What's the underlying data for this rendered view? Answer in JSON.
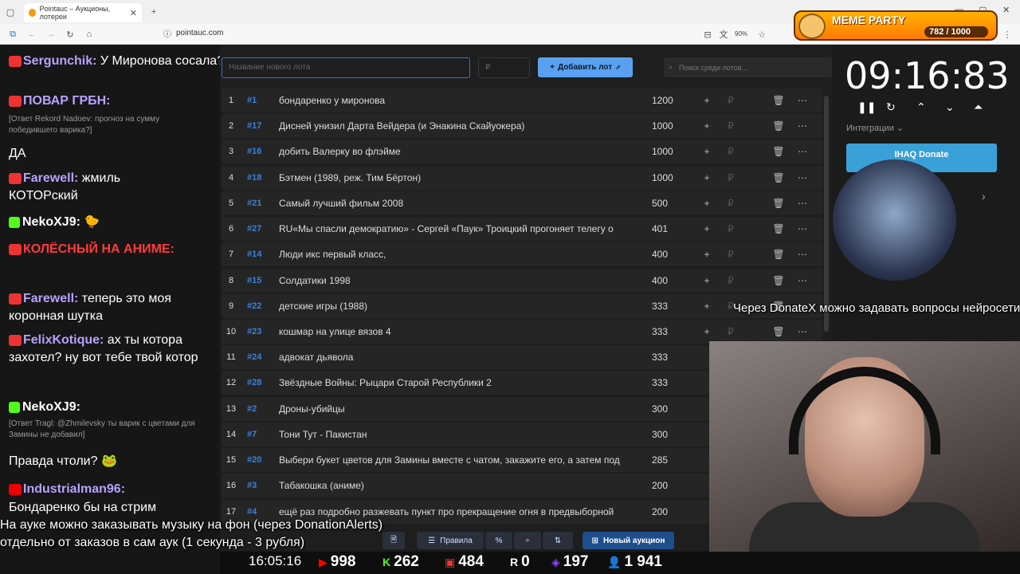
{
  "browser": {
    "tab_title": "Pointauc – Аукционы, лотереи",
    "url": "pointauc.com",
    "zoom": "90%"
  },
  "meme_party": {
    "title": "MEME PARTY",
    "counter": "782 / 1000"
  },
  "chat": [
    {
      "name": "Sergunchik:",
      "text": " У Миронова сосала?",
      "color": "#b8a2ff"
    },
    {
      "name": "ПОВАР ГРБН:",
      "text": "",
      "color": "#b8a2ff"
    },
    {
      "reply": "[Ответ Rekord Nadoev: прогноз на сумму победившего варика?]"
    },
    {
      "text": "ДА"
    },
    {
      "name": "Farewell:",
      "text": " жмиль КОТОРский",
      "color": "#b8a2ff"
    },
    {
      "name": "NekoXJ9:",
      "text": "",
      "color": "#fff"
    },
    {
      "name": "КОЛЁСНЫЙ НА АНИМЕ:",
      "text": "",
      "color": "#ff3b3b"
    },
    {
      "name": "Farewell:",
      "text": " теперь это моя коронная шутка",
      "color": "#b8a2ff"
    },
    {
      "name": "FelixKotique:",
      "text": " ах ты котора захотел? ну вот тебе твой котор",
      "color": "#b8a2ff"
    },
    {
      "name": "NekoXJ9:",
      "text": "",
      "color": "#fff"
    },
    {
      "reply": "[Ответ Tragl: @Zhmilevsky ты варик с цветами для Замины не добавил]"
    },
    {
      "text": "Правда чтоли?"
    },
    {
      "name": "Industrialman96:",
      "text": "",
      "color": "#b8a2ff"
    },
    {
      "text": "Бондаренко бы на стрим"
    }
  ],
  "controls": {
    "lot_placeholder": "Название нового лота",
    "amount_placeholder": "₽",
    "add_label": "Добавить лот",
    "search_placeholder": "Поиск среди лотов..."
  },
  "lots": [
    {
      "i": "1",
      "id": "#1",
      "name": "бондаренко у миронова",
      "amount": "1200"
    },
    {
      "i": "2",
      "id": "#17",
      "name": "Дисней унизил Дарта Вейдера (и Энакина Скайуокера)",
      "amount": "1000"
    },
    {
      "i": "3",
      "id": "#16",
      "name": "добить Валерку во флэйме",
      "amount": "1000"
    },
    {
      "i": "4",
      "id": "#18",
      "name": "Бэтмен (1989, реж. Тим Бёртон)",
      "amount": "1000"
    },
    {
      "i": "5",
      "id": "#21",
      "name": "Самый лучший фильм 2008",
      "amount": "500"
    },
    {
      "i": "6",
      "id": "#27",
      "name": "RU«Мы спасли демократию» - Сергей «Паук» Троицкий прогоняет телегу о",
      "amount": "401"
    },
    {
      "i": "7",
      "id": "#14",
      "name": "Люди икс первый класс,",
      "amount": "400"
    },
    {
      "i": "8",
      "id": "#15",
      "name": "Солдатики 1998",
      "amount": "400"
    },
    {
      "i": "9",
      "id": "#22",
      "name": "детские игры (1988)",
      "amount": "333"
    },
    {
      "i": "10",
      "id": "#23",
      "name": "кошмар на улице вязов 4",
      "amount": "333"
    },
    {
      "i": "11",
      "id": "#24",
      "name": "адвокат дьявола",
      "amount": "333"
    },
    {
      "i": "12",
      "id": "#28",
      "name": "Звёздные Войны: Рыцари Старой Республики 2",
      "amount": "333"
    },
    {
      "i": "13",
      "id": "#2",
      "name": "Дроны-убийцы",
      "amount": "300"
    },
    {
      "i": "14",
      "id": "#7",
      "name": "Тони Тут - Пакистан",
      "amount": "300"
    },
    {
      "i": "15",
      "id": "#20",
      "name": "Выбери букет цветов для Замины вместе с чатом, закажите его, а затем под",
      "amount": "285"
    },
    {
      "i": "16",
      "id": "#3",
      "name": "Табакошка (аниме)",
      "amount": "200"
    },
    {
      "i": "17",
      "id": "#4",
      "name": "ещё раз подробно разжевать пункт про прекращение огня в предвыборной",
      "amount": "200"
    }
  ],
  "timer": {
    "value": "09:16:83",
    "integrations": "Интеграции ⌄",
    "donate": "IHAQ Donate"
  },
  "overlays": {
    "donatex": "Через DonateX можно задавать вопросы нейросети",
    "music1": "На ауке можно заказывать музыку на фон (через DonationAlerts)",
    "music2": "отдельно от заказов в сам аук (1 секунда - 3 рубля)"
  },
  "toolbar": {
    "rules": "Правила",
    "new_auction": "Новый аукцион"
  },
  "stats": {
    "time": "16:05:16",
    "youtube": "998",
    "kick": "262",
    "live": "484",
    "r": "0",
    "twitch": "197",
    "viewers": "1 941"
  },
  "colors": {
    "accent": "#3b82d9",
    "button": "#5aa0f0",
    "panel": "#1e1e1e"
  }
}
